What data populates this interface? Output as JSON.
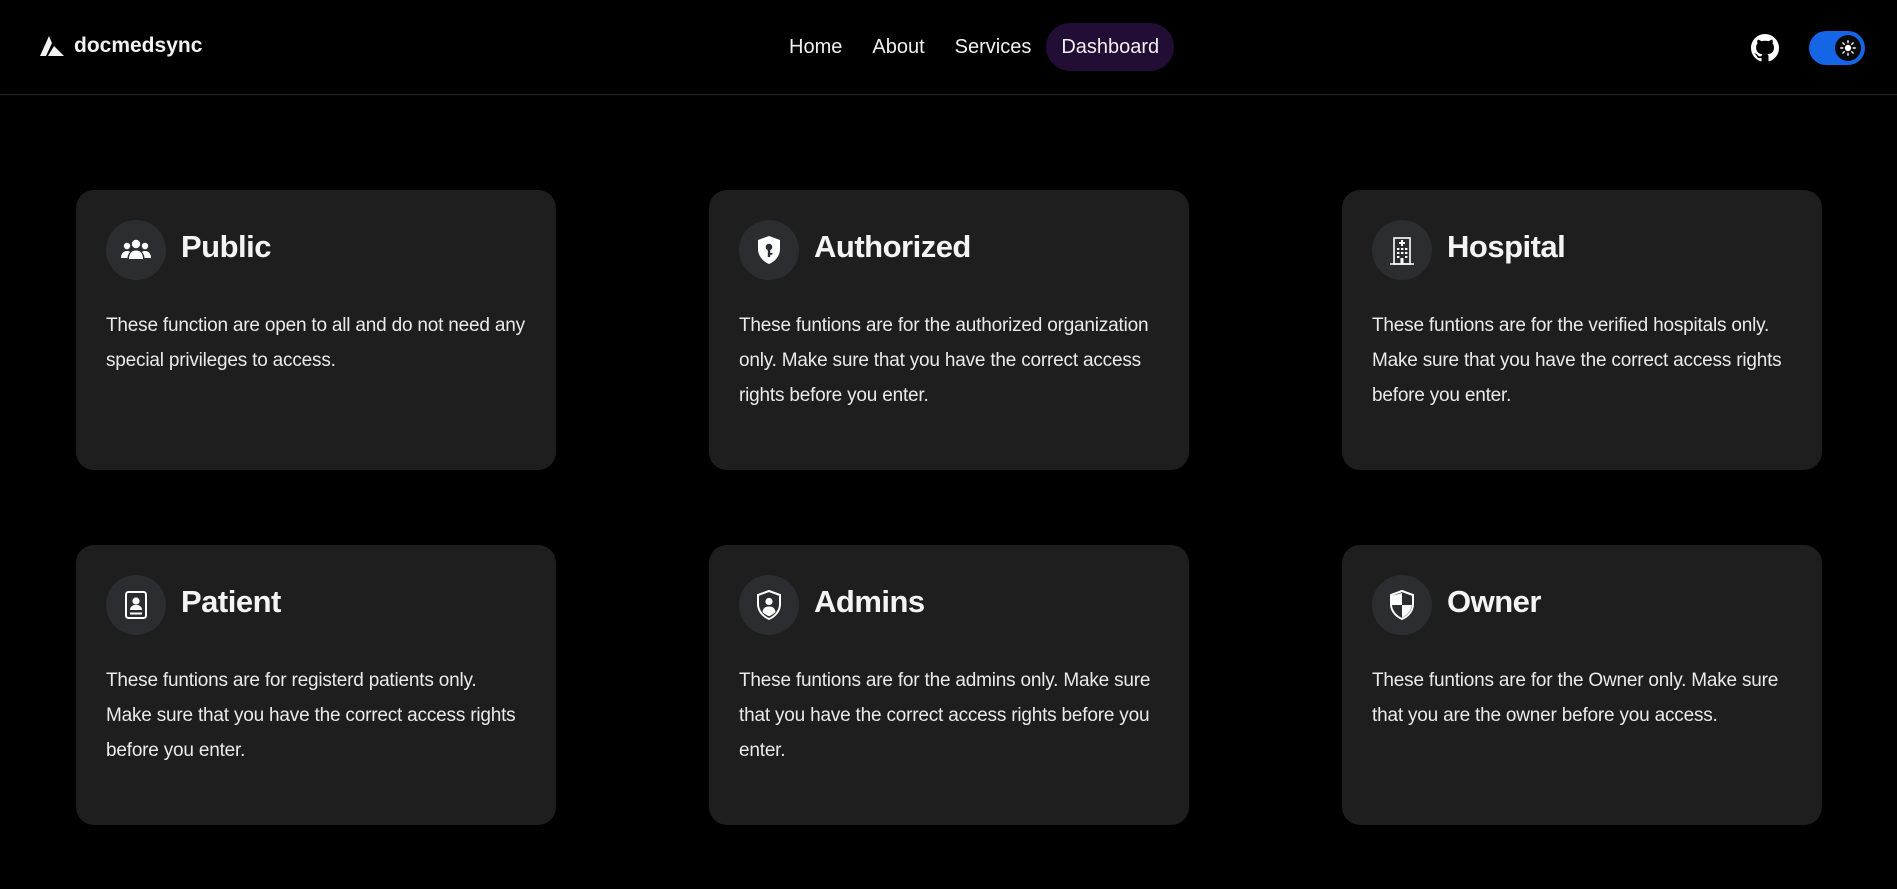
{
  "nav": {
    "brand": "docmedsync",
    "links": [
      "Home",
      "About",
      "Services",
      "Dashboard"
    ],
    "active_link": "Dashboard",
    "icons": {
      "brand": "triangle-logo-icon",
      "github": "github-icon",
      "theme": "sun-icon"
    },
    "colors": {
      "active_bg": "#220d35",
      "toggle": "#1466e6"
    }
  },
  "cards": [
    {
      "title": "Public",
      "icon": "users-icon",
      "text": "These function are open to all and do not need any special privileges to access."
    },
    {
      "title": "Authorized",
      "icon": "shield-key-icon",
      "text": "These funtions are for the authorized organization only. Make sure that you have the correct access rights before you enter."
    },
    {
      "title": "Hospital",
      "icon": "hospital-building-icon",
      "text": "These funtions are for the verified hospitals only. Make sure that you have the correct access rights before you enter."
    },
    {
      "title": "Patient",
      "icon": "id-badge-icon",
      "text": "These funtions are for registerd patients only. Make sure that you have the correct access rights before you enter."
    },
    {
      "title": "Admins",
      "icon": "shield-user-icon",
      "text": "These funtions are for the admins only. Make sure that you have the correct access rights before you enter."
    },
    {
      "title": "Owner",
      "icon": "shield-half-icon",
      "text": "These funtions are for the Owner only. Make sure that you are the owner before you access."
    }
  ],
  "colors": {
    "background": "#000000",
    "card": "#1e1e1f",
    "icon_bg": "#2c2d30"
  }
}
